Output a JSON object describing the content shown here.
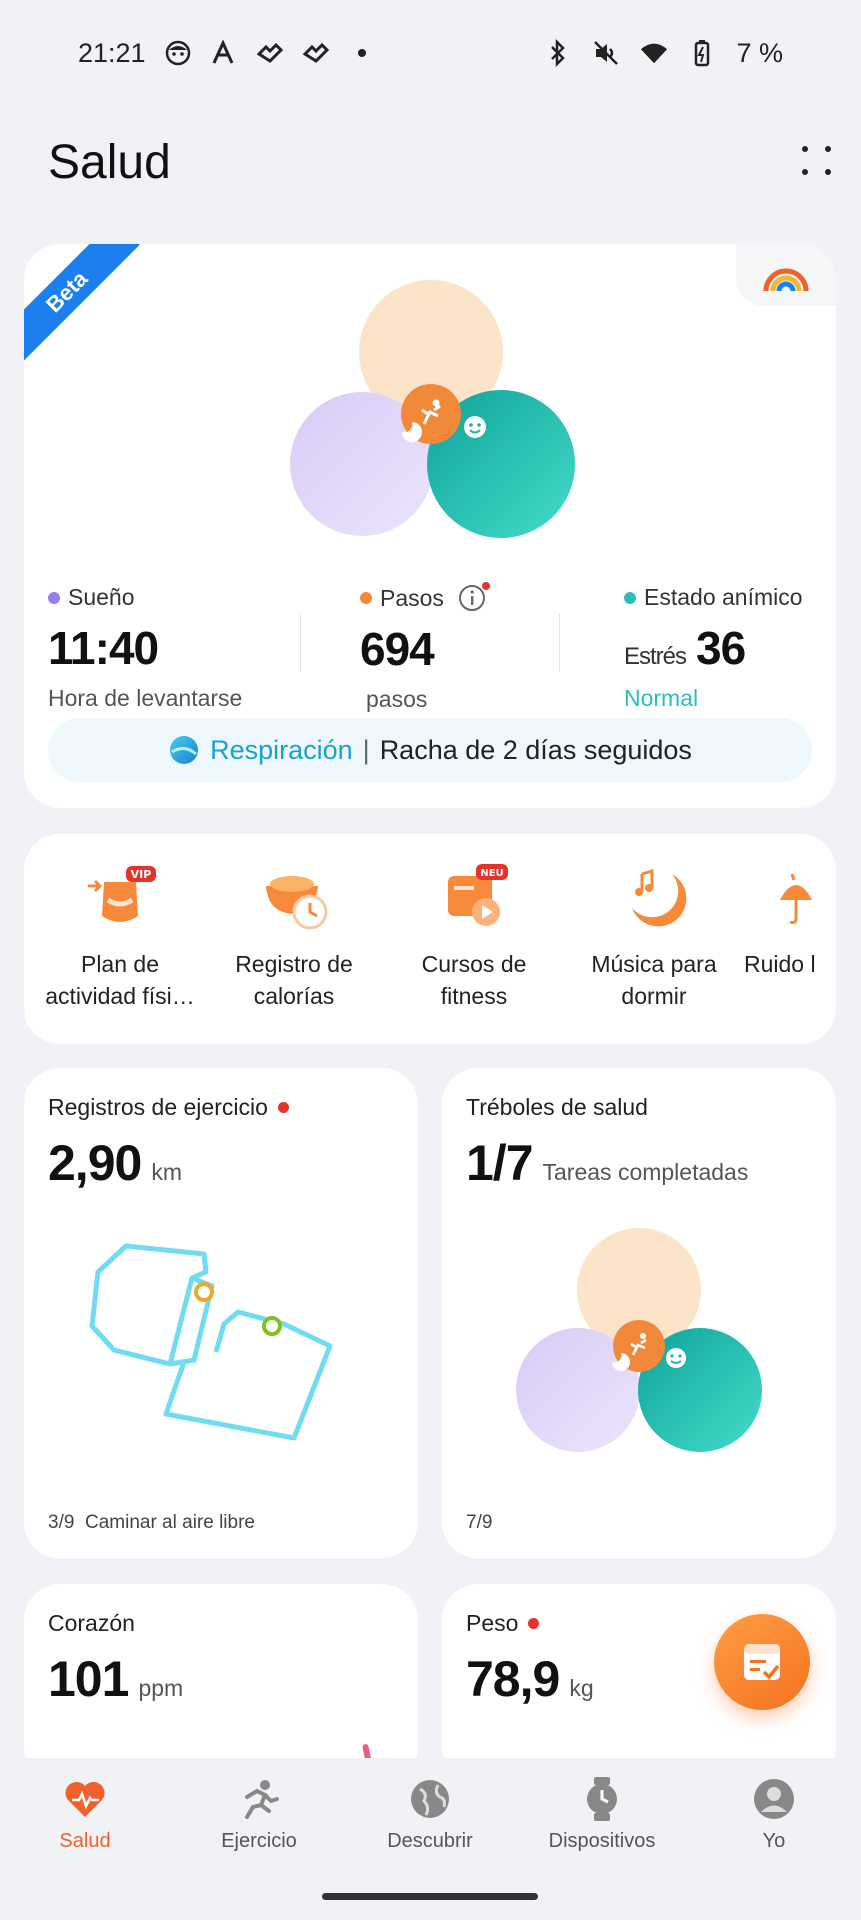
{
  "status_bar": {
    "time": "21:21",
    "battery": "7 %"
  },
  "header": {
    "title": "Salud"
  },
  "summary": {
    "badge": "Beta",
    "sleep": {
      "label": "Sueño",
      "value": "11:40",
      "sub": "Hora de levantarse",
      "color": "#9a7cf0"
    },
    "steps": {
      "label": "Pasos",
      "value": "694",
      "sub": "pasos",
      "color": "#f2893a"
    },
    "mood": {
      "label": "Estado anímico",
      "prefix": "Estrés",
      "value": "36",
      "sub": "Normal",
      "color": "#2bbfb8"
    },
    "streak": {
      "link": "Respiración",
      "separator": "|",
      "text": "Racha de 2 días seguidos"
    }
  },
  "shortcuts": [
    {
      "line1": "Plan de",
      "line2": "actividad físi…",
      "icon": "activity-plan-icon",
      "badge": "VIP"
    },
    {
      "line1": "Registro de",
      "line2": "calorías",
      "icon": "calorie-log-icon"
    },
    {
      "line1": "Cursos de",
      "line2": "fitness",
      "icon": "fitness-courses-icon",
      "badge": "NEU"
    },
    {
      "line1": "Música para",
      "line2": "dormir",
      "icon": "sleep-music-icon"
    },
    {
      "line1": "Ruido l",
      "line2": "",
      "icon": "noise-icon"
    }
  ],
  "tiles": {
    "exercise": {
      "title": "Registros de ejercicio",
      "value": "2,90",
      "unit": "km",
      "footer_count": "3/9",
      "footer_text": "Caminar al aire libre"
    },
    "clovers": {
      "title": "Tréboles de salud",
      "value": "1/7",
      "unit": "Tareas completadas",
      "footer": "7/9"
    },
    "heart": {
      "title": "Corazón",
      "value": "101",
      "unit": "ppm"
    },
    "weight": {
      "title": "Peso",
      "value": "78,9",
      "unit": "kg"
    }
  },
  "nav": [
    {
      "label": "Salud",
      "icon": "heart-icon",
      "active": true
    },
    {
      "label": "Ejercicio",
      "icon": "running-icon"
    },
    {
      "label": "Descubrir",
      "icon": "globe-icon"
    },
    {
      "label": "Dispositivos",
      "icon": "watch-icon"
    },
    {
      "label": "Yo",
      "icon": "profile-icon"
    }
  ],
  "colors": {
    "accent": "#f0612b",
    "teal": "#2bbfb8",
    "link": "#1aa3c9",
    "beta": "#1b7ff0"
  }
}
